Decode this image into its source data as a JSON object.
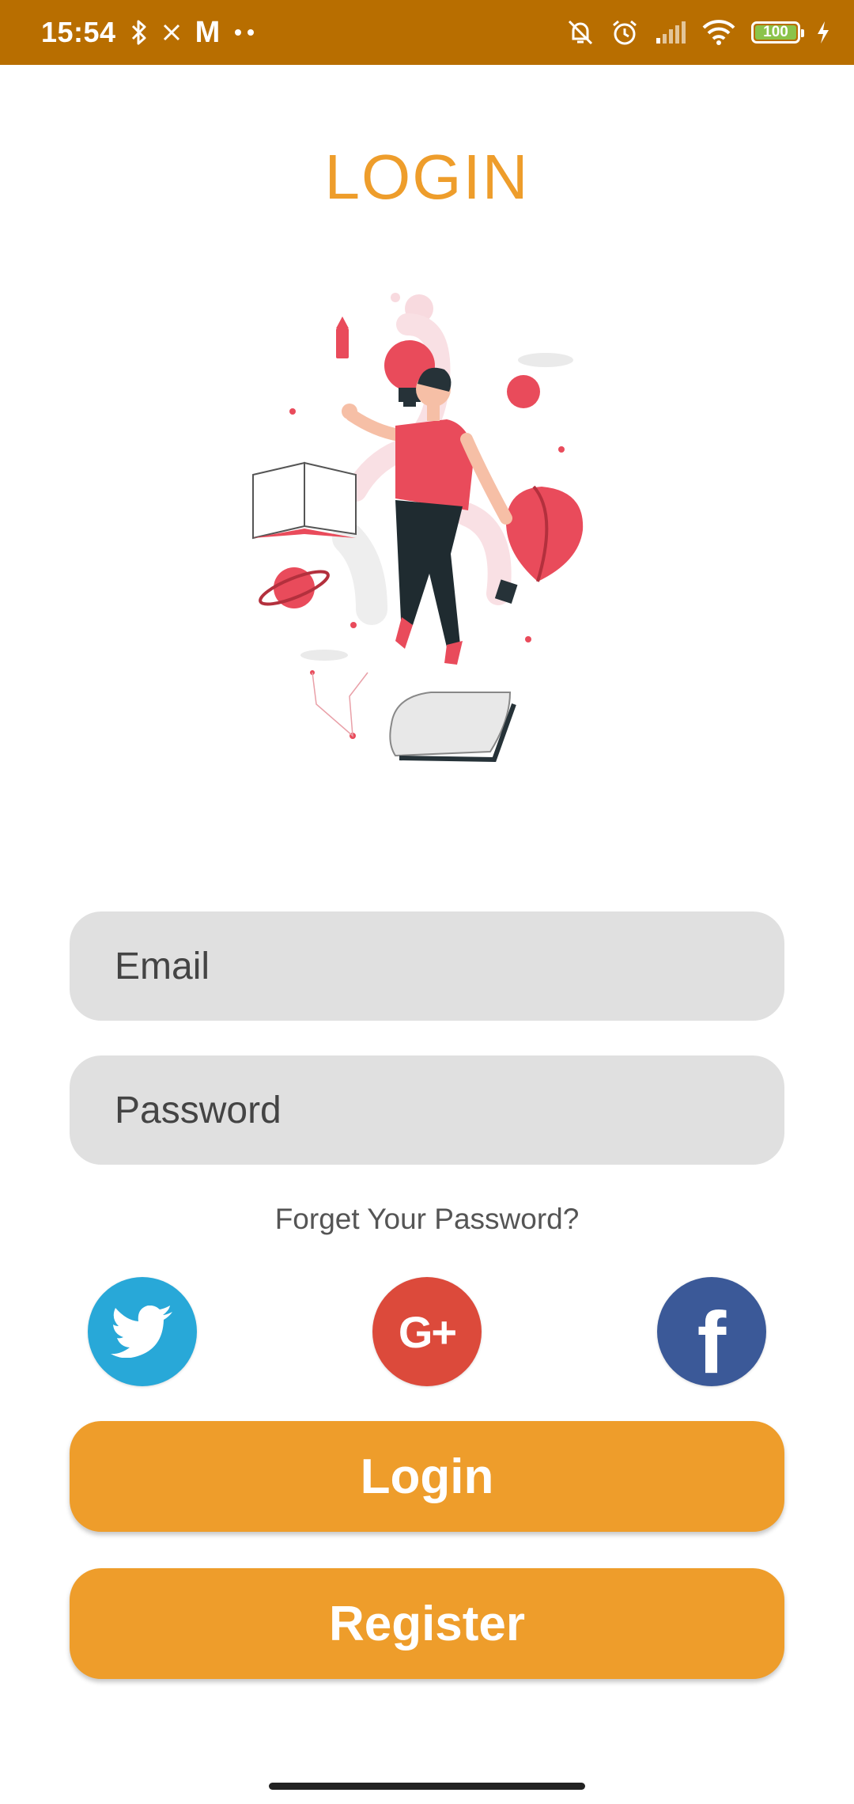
{
  "status_bar": {
    "time": "15:54",
    "mail_app_glyph": "M",
    "battery_level": "100",
    "left_icons": [
      "bluetooth-icon",
      "close-icon",
      "gmail-icon",
      "more-dots-icon"
    ],
    "right_icons": [
      "muted-bell-icon",
      "alarm-icon",
      "signal-icon",
      "wifi-icon",
      "battery-icon",
      "charging-icon"
    ],
    "background_color": "#B86E00"
  },
  "login_screen": {
    "title": "LOGIN",
    "title_color": "#EE9D2B",
    "email_placeholder": "Email",
    "password_placeholder": "Password",
    "forgot_password": "Forget Your Password?",
    "social_logins": [
      {
        "name": "twitter",
        "glyph": "",
        "color": "#28A8D8"
      },
      {
        "name": "google-plus",
        "glyph": "G+",
        "color": "#DC4A3B"
      },
      {
        "name": "facebook",
        "glyph": "f",
        "color": "#3B5998"
      }
    ],
    "login_button": "Login",
    "register_button": "Register",
    "button_color": "#EE9D2B"
  }
}
